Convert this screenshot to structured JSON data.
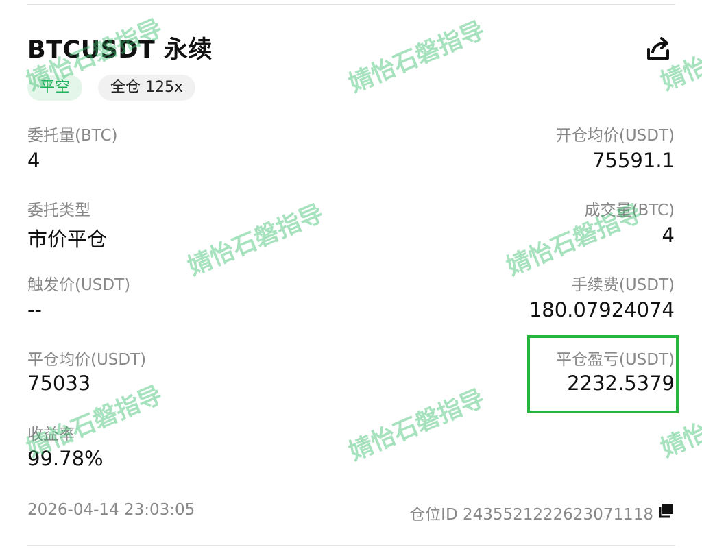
{
  "header": {
    "title": "BTCUSDT 永续",
    "share_icon": "share-icon",
    "tags": [
      "平空",
      "全仓 125x"
    ],
    "tag_color": "#1fb25a"
  },
  "fields": {
    "order_qty": {
      "label": "委托量(BTC)",
      "value": "4"
    },
    "open_avg_price": {
      "label": "开仓均价(USDT)",
      "value": "75591.1"
    },
    "order_type": {
      "label": "委托类型",
      "value": "市价平仓"
    },
    "filled_qty": {
      "label": "成交量(BTC)",
      "value": "4"
    },
    "trigger_price": {
      "label": "触发价(USDT)",
      "value": "--"
    },
    "fee": {
      "label": "手续费(USDT)",
      "value": "180.07924074"
    },
    "close_avg_price": {
      "label": "平仓均价(USDT)",
      "value": "75033"
    },
    "close_pnl": {
      "label": "平仓盈亏(USDT)",
      "value": "2232.5379"
    },
    "yield": {
      "label": "收益率",
      "value": "99.78%"
    }
  },
  "footer": {
    "timestamp": "2026-04-14 23:03:05",
    "position_id": "仓位ID 2435521222623071118",
    "copy_icon": "copy-icon"
  },
  "highlight_color": "#27b53e",
  "watermark": "婧怡石磐指导"
}
